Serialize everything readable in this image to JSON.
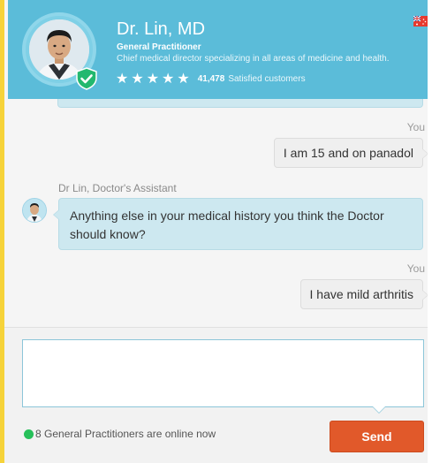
{
  "header": {
    "doctor_name": "Dr. Lin, MD",
    "specialty": "General Practitioner",
    "description": "Chief medical director specializing in all areas of medicine and health.",
    "stars": "★★★★★",
    "rating_count": "41,478",
    "rating_suffix": "Satisfied customers",
    "avatar_icon": "doctor-avatar",
    "badge_icon": "verified-shield-check-icon",
    "flag_icon": "australia-flag-icon"
  },
  "conversation": {
    "messages": [
      {
        "sender": "You",
        "text": "I am 15 and on panadol",
        "side": "right"
      },
      {
        "sender": "Dr Lin, Doctor's Assistant",
        "text": "Anything else in your medical history you think the Doctor should know?",
        "side": "left"
      },
      {
        "sender": "You",
        "text": "I have mild arthritis",
        "side": "right"
      }
    ]
  },
  "composer": {
    "input_value": "",
    "input_placeholder": "",
    "online_text": "8 General Practitioners are online now",
    "send_label": "Send"
  },
  "colors": {
    "header_bg": "#5bbcd9",
    "assistant_bubble": "#cde8f0",
    "send_button": "#e1592a",
    "online_dot": "#27c05a"
  }
}
